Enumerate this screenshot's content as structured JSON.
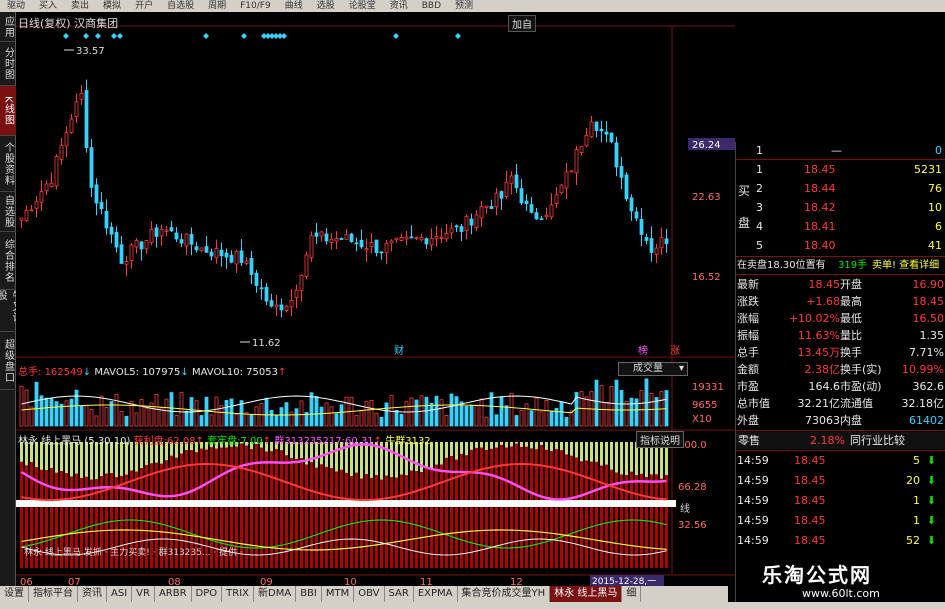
{
  "menubar": [
    "驱动",
    "买入",
    "卖出",
    "模拟",
    "开户",
    "自选股",
    "周期",
    "F10/F9",
    "曲线",
    "选股",
    "论股堂",
    "资讯",
    "BBD",
    "预测"
  ],
  "leftbar": [
    {
      "label": "应用",
      "active": false
    },
    {
      "label": "分时图",
      "active": false
    },
    {
      "label": "K线图",
      "active": true
    },
    {
      "label": "个股资料",
      "active": false
    },
    {
      "label": "自选股",
      "active": false
    },
    {
      "label": "综合排名",
      "active": false
    },
    {
      "label": "牛叉诊股",
      "active": false
    },
    {
      "label": "超级盘口",
      "active": false
    }
  ],
  "chart": {
    "title": "日线(复权) 汉商集团",
    "add_label": "加自",
    "high_label": "33.57",
    "low_label": "11.62",
    "price_ticks": [
      "26.24",
      "22.63",
      "16.52"
    ],
    "event_labels": [
      "财",
      "榜",
      "涨"
    ],
    "volume_info": {
      "total_label": "总手:",
      "total": "162549",
      "mavol5_label": "MAVOL5:",
      "mavol5": "107975",
      "mavol10_label": "MAVOL10:",
      "mavol10": "75053"
    },
    "volume_select": "成交量",
    "volume_ticks": [
      "19331",
      "9655",
      "X10"
    ],
    "indicator_info": {
      "name": "林永 线上黑马",
      "params": "(5,30,10)",
      "profit_label": "获利盘:",
      "profit": "62.08",
      "locked_label": "套牢盘:",
      "locked": "7.00",
      "group1": "群313235217:",
      "group1_val": "60.31",
      "bull": "牛群3132"
    },
    "indicator_help": "指标说明",
    "indicator_ticks": [
      "100.0",
      "66.28",
      "32.56"
    ],
    "indicator_side_label": "线",
    "indicator_bottom_text": "林永 线上黑马 发抓 · 主力买卖! · 群313235... · 提供 ·",
    "date_labels": [
      "06",
      "07",
      "08",
      "09",
      "10",
      "11",
      "12"
    ],
    "date_tag": "2015-12-28,一"
  },
  "quote": {
    "header": "26.24",
    "sell_label": "卖",
    "sell_label2": "盘",
    "buy_label": "买",
    "buy_label2": "盘",
    "sell_rows": [
      {
        "level": "1",
        "price": "",
        "vol": ""
      }
    ],
    "buy_rows": [
      {
        "level": "1",
        "price": "18.45",
        "vol": "5231"
      },
      {
        "level": "2",
        "price": "18.44",
        "vol": "76"
      },
      {
        "level": "3",
        "price": "18.42",
        "vol": "10"
      },
      {
        "level": "4",
        "price": "18.41",
        "vol": "6"
      },
      {
        "level": "5",
        "price": "18.40",
        "vol": "41"
      }
    ],
    "top_sell": {
      "level": "1",
      "price": "—",
      "vol": "0"
    },
    "message": "在卖盘18.30位置有",
    "message_vol": "319手",
    "message_tail": "卖单! 查看详细",
    "stats": [
      {
        "l1": "最新",
        "v1": "18.45",
        "l2": "开盘",
        "v2": "16.90"
      },
      {
        "l1": "涨跌",
        "v1": "+1.68",
        "l2": "最高",
        "v2": "18.45"
      },
      {
        "l1": "涨幅",
        "v1": "+10.02%",
        "l2": "最低",
        "v2": "16.50"
      },
      {
        "l1": "振幅",
        "v1": "11.63%",
        "l2": "量比",
        "v2": "1.35"
      },
      {
        "l1": "总手",
        "v1": "13.45万",
        "l2": "换手",
        "v2": "7.71%"
      },
      {
        "l1": "金额",
        "v1": "2.38亿",
        "l2": "换手(实)",
        "v2": "10.99%"
      },
      {
        "l1": "市盈",
        "v1": "164.6",
        "l2": "市盈(动)",
        "v2": "362.6"
      },
      {
        "l1": "总市值",
        "v1": "32.21亿",
        "l2": "流通值",
        "v2": "32.18亿"
      },
      {
        "l1": "外盘",
        "v1": "73063",
        "l2": "内盘",
        "v2": "61402"
      }
    ],
    "tab_left": "零售",
    "tab_pct": "2.18%",
    "tab_right": "同行业比较",
    "ticks": [
      {
        "time": "14:59",
        "price": "18.45",
        "vol": "5"
      },
      {
        "time": "14:59",
        "price": "18.45",
        "vol": "20"
      },
      {
        "time": "14:59",
        "price": "18.45",
        "vol": "1"
      },
      {
        "time": "14:59",
        "price": "18.45",
        "vol": "1"
      },
      {
        "time": "14:59",
        "price": "18.45",
        "vol": "52"
      }
    ]
  },
  "bottombar": [
    "设置",
    "指标平台",
    "资讯",
    "ASI",
    "VR",
    "ARBR",
    "DPO",
    "TRIX",
    "新DMA",
    "BBI",
    "MTM",
    "OBV",
    "SAR",
    "EXPMA",
    "集合竞价成交量YH",
    "林永 线上黑马",
    "细"
  ],
  "bottombar_active": "林永 线上黑马",
  "watermark": {
    "title": "乐淘公式网",
    "url": "www.60lt.com"
  },
  "colors": {
    "up": "#ff3b3b",
    "down": "#37d3ff",
    "ma": "#ffffff",
    "accent": "#7a1010"
  }
}
